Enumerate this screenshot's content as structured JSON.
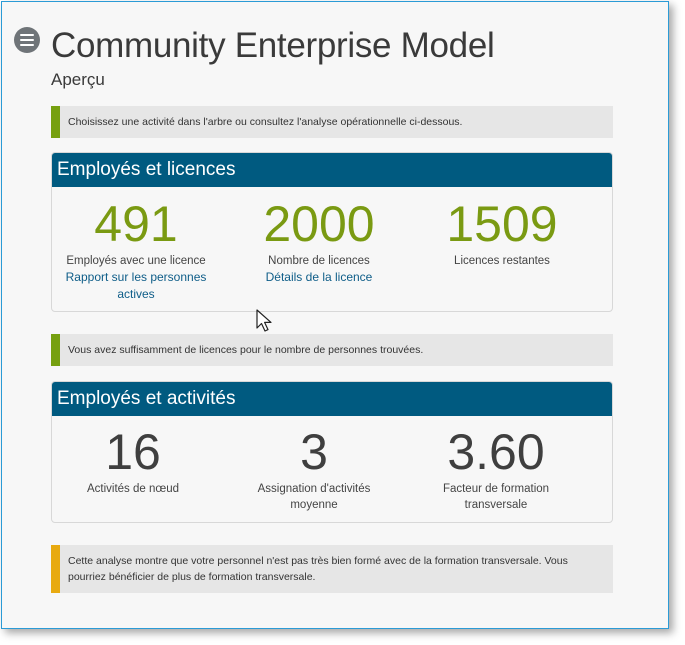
{
  "header": {
    "title": "Community Enterprise Model",
    "subtitle": "Aperçu"
  },
  "notices": {
    "intro": "Choisissez une activité dans l'arbre ou consultez l'analyse opérationnelle ci-dessous.",
    "licences_ok": "Vous avez suffisamment de licences pour le nombre de personnes trouvées.",
    "analysis": "Cette analyse montre que votre personnel n'est pas très bien formé avec de la formation transversale. Vous pourriez bénéficier de plus de formation transversale."
  },
  "licences_panel": {
    "title": "Employés et licences",
    "stats": [
      {
        "value": "491",
        "label": "Employés avec une licence",
        "link": "Rapport sur les personnes actives"
      },
      {
        "value": "2000",
        "label": "Nombre de licences",
        "link": "Détails de la licence"
      },
      {
        "value": "1509",
        "label": "Licences restantes"
      }
    ]
  },
  "activities_panel": {
    "title": "Employés et activités",
    "stats": [
      {
        "value": "16",
        "label": "Activités de nœud"
      },
      {
        "value": "3",
        "label": "Assignation d'activités moyenne"
      },
      {
        "value": "3.60",
        "label": "Facteur de formation transversale"
      }
    ]
  },
  "colors": {
    "header_bg": "#005a80",
    "accent_green": "#76a010",
    "accent_amber": "#e8aa10",
    "link": "#0e5d88"
  },
  "icons": {
    "menu": "hamburger-menu-icon",
    "cursor": "mouse-pointer-icon"
  }
}
